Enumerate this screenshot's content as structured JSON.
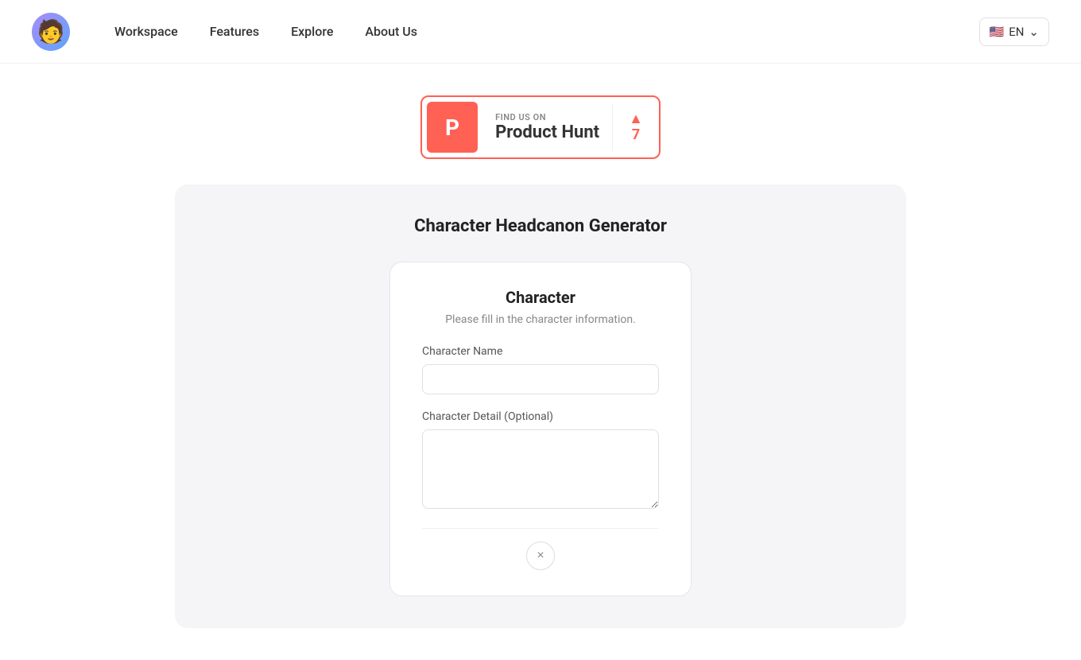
{
  "navbar": {
    "logo_emoji": "🧑",
    "links": [
      {
        "id": "workspace",
        "label": "Workspace"
      },
      {
        "id": "features",
        "label": "Features"
      },
      {
        "id": "explore",
        "label": "Explore"
      },
      {
        "id": "about-us",
        "label": "About Us"
      }
    ],
    "lang_flag": "🇺🇸",
    "lang_code": "EN"
  },
  "product_hunt": {
    "find_us_label": "FIND US ON",
    "name": "Product Hunt",
    "vote_count": "7",
    "p_letter": "P"
  },
  "main": {
    "page_title": "Character Headcanon Generator"
  },
  "character_card": {
    "title": "Character",
    "subtitle": "Please fill in the character information.",
    "name_label": "Character Name",
    "name_placeholder": "",
    "detail_label": "Character Detail (Optional)",
    "detail_placeholder": ""
  },
  "close_button": {
    "symbol": "×"
  }
}
